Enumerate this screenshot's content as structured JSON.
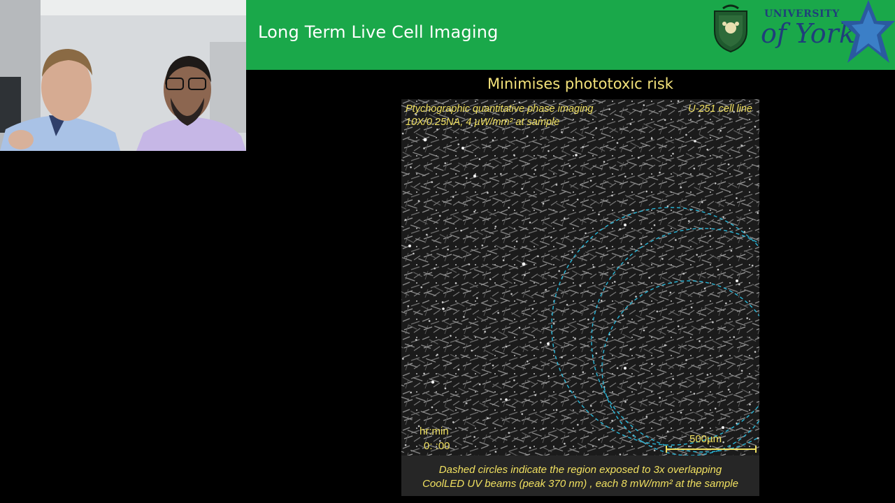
{
  "slide": {
    "title": "Long Term Live Cell Imaging",
    "subtitle": "Minimises phototoxic risk",
    "logo": {
      "line1": "UNIVERSITY",
      "line2": "of York"
    },
    "colors": {
      "header": "#1aa84a",
      "annotation": "#f0e060",
      "circles": "#29b6d8"
    }
  },
  "micro": {
    "label_method": "Ptychographic quantitative phase imaging",
    "label_params": "10X/0.25NA, 4 µW/mm² at sample",
    "label_cellline": "U-251 cell line",
    "time_label": "hr:min",
    "time_value": "0: :00",
    "scale_label": "500µm"
  },
  "caption": {
    "line1": "Dashed circles indicate the region exposed to 3x overlapping",
    "line2": "CoolLED UV beams (peak 370 nm) , each 8 mW/mm² at the sample"
  }
}
